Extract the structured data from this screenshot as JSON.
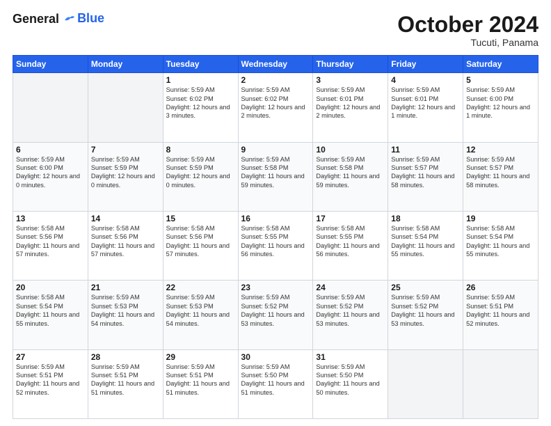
{
  "header": {
    "logo_general": "General",
    "logo_blue": "Blue",
    "month_title": "October 2024",
    "location": "Tucuti, Panama"
  },
  "weekdays": [
    "Sunday",
    "Monday",
    "Tuesday",
    "Wednesday",
    "Thursday",
    "Friday",
    "Saturday"
  ],
  "weeks": [
    [
      {
        "day": "",
        "info": ""
      },
      {
        "day": "",
        "info": ""
      },
      {
        "day": "1",
        "info": "Sunrise: 5:59 AM\nSunset: 6:02 PM\nDaylight: 12 hours\nand 3 minutes."
      },
      {
        "day": "2",
        "info": "Sunrise: 5:59 AM\nSunset: 6:02 PM\nDaylight: 12 hours\nand 2 minutes."
      },
      {
        "day": "3",
        "info": "Sunrise: 5:59 AM\nSunset: 6:01 PM\nDaylight: 12 hours\nand 2 minutes."
      },
      {
        "day": "4",
        "info": "Sunrise: 5:59 AM\nSunset: 6:01 PM\nDaylight: 12 hours\nand 1 minute."
      },
      {
        "day": "5",
        "info": "Sunrise: 5:59 AM\nSunset: 6:00 PM\nDaylight: 12 hours\nand 1 minute."
      }
    ],
    [
      {
        "day": "6",
        "info": "Sunrise: 5:59 AM\nSunset: 6:00 PM\nDaylight: 12 hours\nand 0 minutes."
      },
      {
        "day": "7",
        "info": "Sunrise: 5:59 AM\nSunset: 5:59 PM\nDaylight: 12 hours\nand 0 minutes."
      },
      {
        "day": "8",
        "info": "Sunrise: 5:59 AM\nSunset: 5:59 PM\nDaylight: 12 hours\nand 0 minutes."
      },
      {
        "day": "9",
        "info": "Sunrise: 5:59 AM\nSunset: 5:58 PM\nDaylight: 11 hours\nand 59 minutes."
      },
      {
        "day": "10",
        "info": "Sunrise: 5:59 AM\nSunset: 5:58 PM\nDaylight: 11 hours\nand 59 minutes."
      },
      {
        "day": "11",
        "info": "Sunrise: 5:59 AM\nSunset: 5:57 PM\nDaylight: 11 hours\nand 58 minutes."
      },
      {
        "day": "12",
        "info": "Sunrise: 5:59 AM\nSunset: 5:57 PM\nDaylight: 11 hours\nand 58 minutes."
      }
    ],
    [
      {
        "day": "13",
        "info": "Sunrise: 5:58 AM\nSunset: 5:56 PM\nDaylight: 11 hours\nand 57 minutes."
      },
      {
        "day": "14",
        "info": "Sunrise: 5:58 AM\nSunset: 5:56 PM\nDaylight: 11 hours\nand 57 minutes."
      },
      {
        "day": "15",
        "info": "Sunrise: 5:58 AM\nSunset: 5:56 PM\nDaylight: 11 hours\nand 57 minutes."
      },
      {
        "day": "16",
        "info": "Sunrise: 5:58 AM\nSunset: 5:55 PM\nDaylight: 11 hours\nand 56 minutes."
      },
      {
        "day": "17",
        "info": "Sunrise: 5:58 AM\nSunset: 5:55 PM\nDaylight: 11 hours\nand 56 minutes."
      },
      {
        "day": "18",
        "info": "Sunrise: 5:58 AM\nSunset: 5:54 PM\nDaylight: 11 hours\nand 55 minutes."
      },
      {
        "day": "19",
        "info": "Sunrise: 5:58 AM\nSunset: 5:54 PM\nDaylight: 11 hours\nand 55 minutes."
      }
    ],
    [
      {
        "day": "20",
        "info": "Sunrise: 5:58 AM\nSunset: 5:54 PM\nDaylight: 11 hours\nand 55 minutes."
      },
      {
        "day": "21",
        "info": "Sunrise: 5:59 AM\nSunset: 5:53 PM\nDaylight: 11 hours\nand 54 minutes."
      },
      {
        "day": "22",
        "info": "Sunrise: 5:59 AM\nSunset: 5:53 PM\nDaylight: 11 hours\nand 54 minutes."
      },
      {
        "day": "23",
        "info": "Sunrise: 5:59 AM\nSunset: 5:52 PM\nDaylight: 11 hours\nand 53 minutes."
      },
      {
        "day": "24",
        "info": "Sunrise: 5:59 AM\nSunset: 5:52 PM\nDaylight: 11 hours\nand 53 minutes."
      },
      {
        "day": "25",
        "info": "Sunrise: 5:59 AM\nSunset: 5:52 PM\nDaylight: 11 hours\nand 53 minutes."
      },
      {
        "day": "26",
        "info": "Sunrise: 5:59 AM\nSunset: 5:51 PM\nDaylight: 11 hours\nand 52 minutes."
      }
    ],
    [
      {
        "day": "27",
        "info": "Sunrise: 5:59 AM\nSunset: 5:51 PM\nDaylight: 11 hours\nand 52 minutes."
      },
      {
        "day": "28",
        "info": "Sunrise: 5:59 AM\nSunset: 5:51 PM\nDaylight: 11 hours\nand 51 minutes."
      },
      {
        "day": "29",
        "info": "Sunrise: 5:59 AM\nSunset: 5:51 PM\nDaylight: 11 hours\nand 51 minutes."
      },
      {
        "day": "30",
        "info": "Sunrise: 5:59 AM\nSunset: 5:50 PM\nDaylight: 11 hours\nand 51 minutes."
      },
      {
        "day": "31",
        "info": "Sunrise: 5:59 AM\nSunset: 5:50 PM\nDaylight: 11 hours\nand 50 minutes."
      },
      {
        "day": "",
        "info": ""
      },
      {
        "day": "",
        "info": ""
      }
    ]
  ]
}
